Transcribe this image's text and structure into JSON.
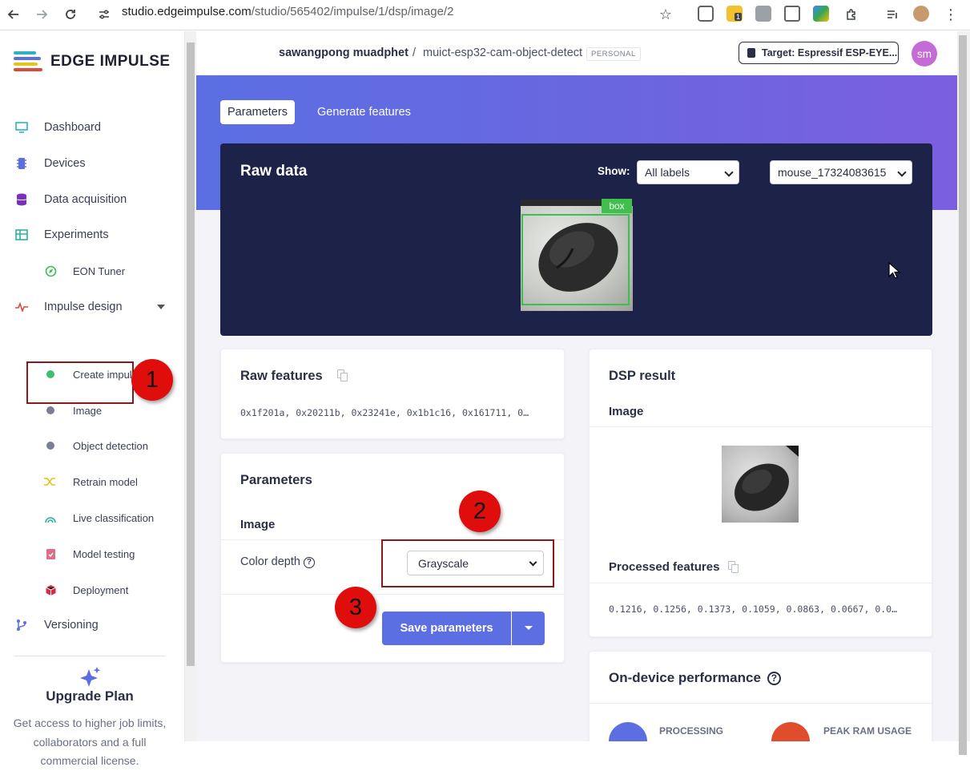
{
  "browser": {
    "url_host": "studio.edgeimpulse.com",
    "url_path": "/studio/565402/impulse/1/dsp/image/2",
    "extension_badge": "1"
  },
  "sidebar": {
    "logo_text": "EDGE IMPULSE",
    "items": [
      {
        "label": "Dashboard",
        "icon": "monitor-icon",
        "color": "#2bb3c0"
      },
      {
        "label": "Devices",
        "icon": "chip-icon",
        "color": "#5b6fe3"
      },
      {
        "label": "Data acquisition",
        "icon": "database-icon",
        "color": "#7b2fbf"
      },
      {
        "label": "Experiments",
        "icon": "table-icon",
        "color": "#2bb39a"
      },
      {
        "label": "EON Tuner",
        "icon": "compass-icon",
        "color": "#3fbf4c"
      },
      {
        "label": "Impulse design",
        "icon": "pulse-icon",
        "color": "#e0483c"
      },
      {
        "label": "Create impulse",
        "icon": "green-dot-icon",
        "color": "#3fbf6a"
      },
      {
        "label": "Image",
        "icon": "gray-dot-icon",
        "color": "#7a7e92"
      },
      {
        "label": "Object detection",
        "icon": "gray-dot-icon",
        "color": "#7a7e92"
      },
      {
        "label": "Retrain model",
        "icon": "shuffle-icon",
        "color": "#e8c21a"
      },
      {
        "label": "Live classification",
        "icon": "signal-icon",
        "color": "#2bb39a"
      },
      {
        "label": "Model testing",
        "icon": "clipboard-icon",
        "color": "#e06c8a"
      },
      {
        "label": "Deployment",
        "icon": "cube-icon",
        "color": "#d62b4b"
      },
      {
        "label": "Versioning",
        "icon": "branch-icon",
        "color": "#5b6fe3"
      }
    ],
    "upgrade": {
      "title": "Upgrade Plan",
      "description": "Get access to higher job limits, collaborators and a full commercial license."
    }
  },
  "header": {
    "user": "sawangpong muadphet",
    "separator": "/",
    "project": "muict-esp32-cam-object-detect",
    "badge": "PERSONAL",
    "target": "Target: Espressif ESP-EYE...",
    "avatar": "sm"
  },
  "tabs": [
    "Parameters",
    "Generate features"
  ],
  "raw_data": {
    "title": "Raw data",
    "show_label": "Show:",
    "show_value": "All labels",
    "sample_value": "mouse_17324083615",
    "bbox_label": "box"
  },
  "raw_features": {
    "title": "Raw features",
    "values": "0x1f201a, 0x20211b, 0x23241e, 0x1b1c16, 0x161711, 0…"
  },
  "parameters": {
    "title": "Parameters",
    "section": "Image",
    "color_depth_label": "Color depth",
    "color_depth_value": "Grayscale",
    "save_label": "Save parameters"
  },
  "dsp_result": {
    "title": "DSP result",
    "section": "Image",
    "processed_label": "Processed features",
    "processed_values": "0.1216, 0.1256, 0.1373, 0.1059, 0.0863, 0.0667, 0.0…"
  },
  "performance": {
    "title": "On-device performance",
    "processing_label": "PROCESSING",
    "ram_label": "PEAK RAM USAGE"
  },
  "annotations": [
    "1",
    "2",
    "3"
  ]
}
